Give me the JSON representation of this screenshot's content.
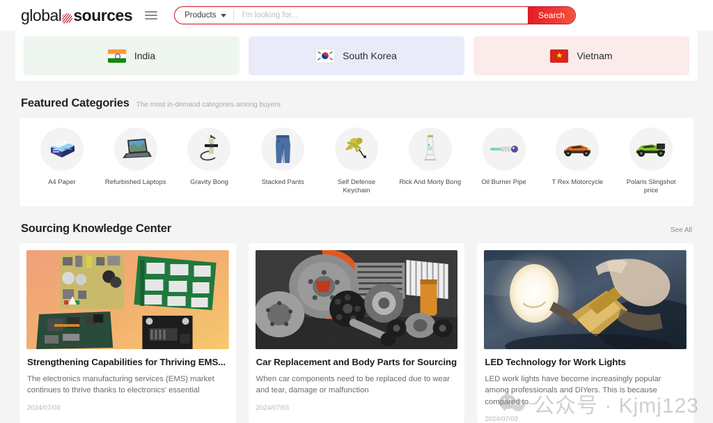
{
  "header": {
    "logo_part_a": "global",
    "logo_mark": "swoosh-logo-mark",
    "logo_part_b": "sources",
    "menu_icon": "list-menu-icon",
    "search": {
      "category_label": "Products",
      "category_caret": "chevron-down-icon",
      "placeholder": "I'm looking for...",
      "value": "",
      "button_label": "Search"
    }
  },
  "countries": [
    {
      "name": "India",
      "flag": "flag-india",
      "bg": "#eef6ef"
    },
    {
      "name": "South Korea",
      "flag": "flag-south-korea",
      "bg": "#e9ecf8"
    },
    {
      "name": "Vietnam",
      "flag": "flag-vietnam",
      "bg": "#fbeceb"
    }
  ],
  "featured": {
    "title": "Featured Categories",
    "subtitle": "The most in-demand categories among buyers.",
    "items": [
      {
        "label": "A4 Paper",
        "thumb": "a4-paper-thumb"
      },
      {
        "label": "Refurbished Laptops",
        "thumb": "laptop-thumb"
      },
      {
        "label": "Gravity Bong",
        "thumb": "gravity-bong-thumb"
      },
      {
        "label": "Stacked Pants",
        "thumb": "stacked-pants-thumb"
      },
      {
        "label": "Self Defense Keychain",
        "thumb": "keychain-thumb"
      },
      {
        "label": "Rick And Morty Bong",
        "thumb": "rick-morty-bong-thumb"
      },
      {
        "label": "Oil Burner Pipe",
        "thumb": "oil-burner-pipe-thumb"
      },
      {
        "label": "T Rex Motorcycle",
        "thumb": "t-rex-motorcycle-thumb"
      },
      {
        "label": "Polaris Slingshot price",
        "thumb": "polaris-slingshot-thumb"
      }
    ]
  },
  "knowledge": {
    "title": "Sourcing Knowledge Center",
    "see_all": "See All",
    "articles": [
      {
        "image": "circuit-boards-photo",
        "title": "Strengthening Capabilities for Thriving EMS...",
        "desc": "The electronics manufacturing services (EMS) market continues to thrive thanks to electronics' essential",
        "date": "2024/07/03"
      },
      {
        "image": "car-parts-photo",
        "title": "Car Replacement and Body Parts for Sourcing",
        "desc": "When car components need to be replaced due to wear and tear, damage or malfunction",
        "date": "2024/07/03"
      },
      {
        "image": "work-light-photo",
        "title": "LED Technology for Work Lights",
        "desc": "LED work lights have become increasingly popular among professionals and DIYers. This is because compared to...",
        "date": "2024/07/03"
      }
    ]
  },
  "watermark": {
    "icon": "wechat-icon",
    "text": "公众号 · Kjmj123"
  },
  "colors": {
    "brand_red": "#c8102e",
    "search_button": "#e01b24",
    "page_bg": "#f4f4f4"
  }
}
